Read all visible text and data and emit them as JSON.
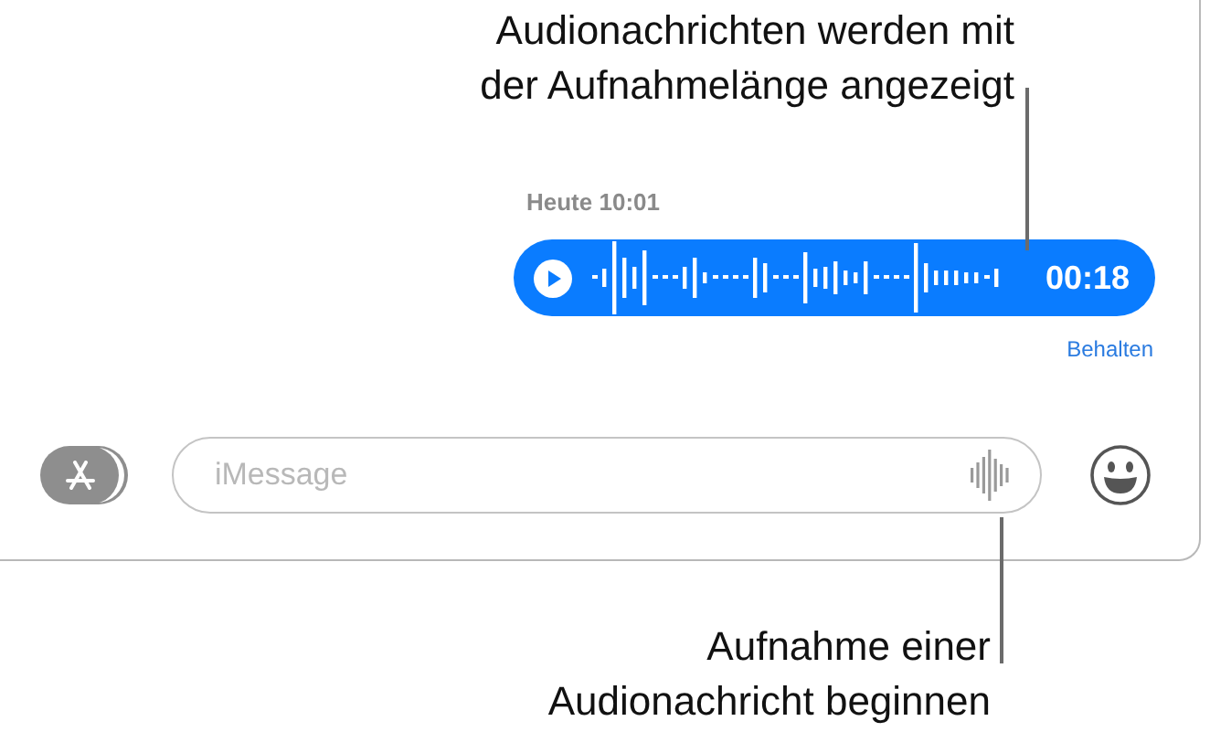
{
  "callouts": [
    {
      "text": "Audionachrichten werden mit\nder Aufnahmelänge angezeigt"
    },
    {
      "text": "Aufnahme einer\nAudionachricht beginnen"
    }
  ],
  "conversation": {
    "timestamp": "Heute 10:01",
    "audio_message": {
      "duration": "00:18"
    },
    "keep_link": "Behalten"
  },
  "composer": {
    "placeholder": "iMessage"
  }
}
